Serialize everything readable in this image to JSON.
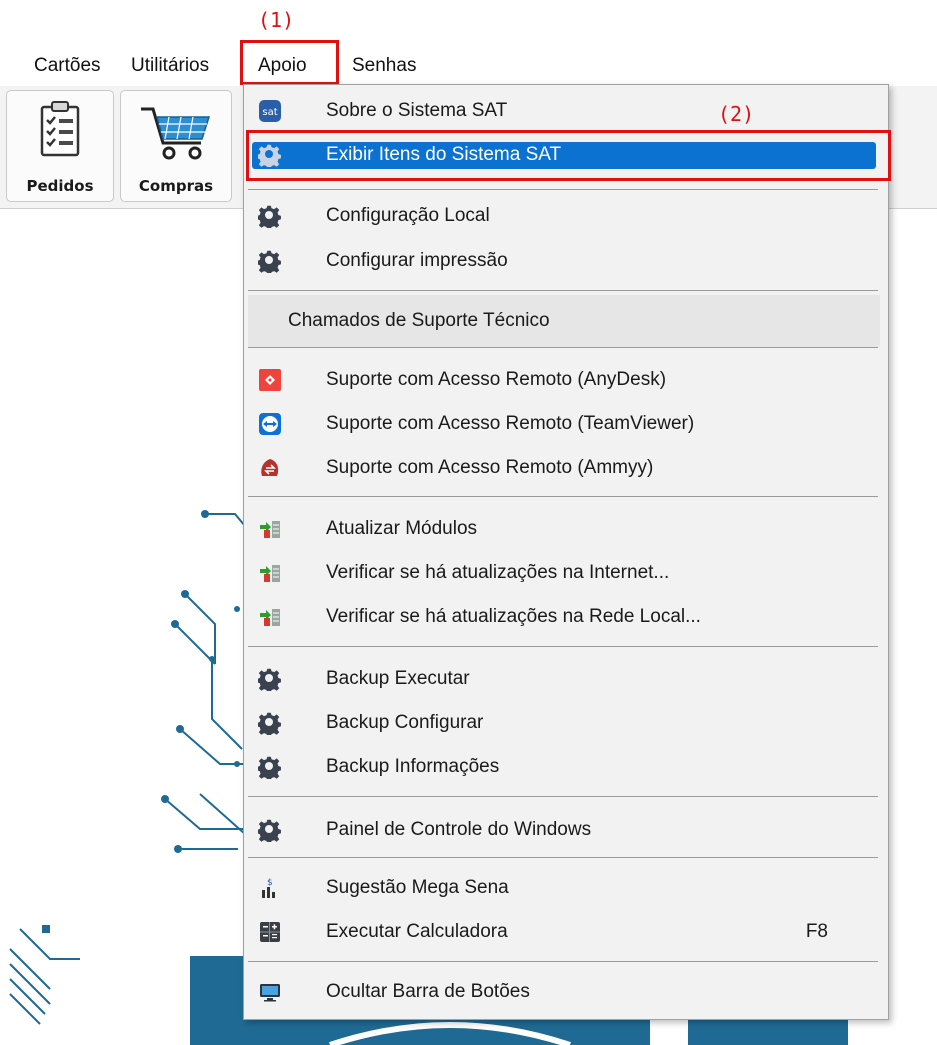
{
  "annotations": {
    "step1": "(1)",
    "step2": "(2)"
  },
  "menubar": {
    "items": [
      {
        "label": "Cartões"
      },
      {
        "label": "Utilitários"
      },
      {
        "label": "Apoio"
      },
      {
        "label": "Senhas"
      }
    ]
  },
  "toolbar": {
    "buttons": [
      {
        "label": "Pedidos",
        "icon": "clipboard-checklist-icon"
      },
      {
        "label": "Compras",
        "icon": "shopping-cart-icon"
      }
    ]
  },
  "menu": {
    "items": {
      "sobre": "Sobre o Sistema SAT",
      "exibir": "Exibir Itens do Sistema SAT",
      "config_local": "Configuração Local",
      "config_impressao": "Configurar impressão",
      "chamados_header": "Chamados de Suporte Técnico",
      "anydesk": "Suporte com Acesso Remoto (AnyDesk)",
      "teamviewer": "Suporte com Acesso Remoto (TeamViewer)",
      "ammyy": "Suporte com Acesso Remoto (Ammyy)",
      "atualizar": "Atualizar Módulos",
      "verificar_internet": "Verificar se há atualizações na Internet...",
      "verificar_rede": "Verificar se há atualizações na Rede Local...",
      "backup_executar": "Backup Executar",
      "backup_configurar": "Backup Configurar",
      "backup_info": "Backup Informações",
      "painel": "Painel de Controle do Windows",
      "mega_sena": "Sugestão Mega Sena",
      "calculadora": "Executar Calculadora",
      "calculadora_shortcut": "F8",
      "ocultar": "Ocultar Barra de Botões"
    }
  },
  "colors": {
    "highlight": "#0b72d1",
    "annotation_red": "#e11010",
    "circuit_blue": "#1f6a94"
  }
}
